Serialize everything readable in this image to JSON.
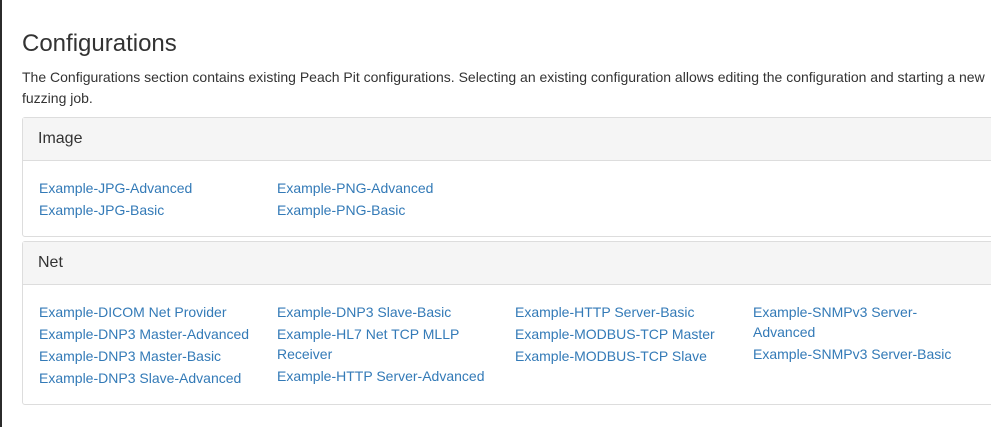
{
  "page": {
    "title": "Configurations",
    "description": "The Configurations section contains existing Peach Pit configurations. Selecting an existing configuration allows editing the configuration and starting a new fuzzing job."
  },
  "panels": [
    {
      "heading": "Image",
      "columns": [
        [
          "Example-JPG-Advanced",
          "Example-JPG-Basic"
        ],
        [
          "Example-PNG-Advanced",
          "Example-PNG-Basic"
        ]
      ]
    },
    {
      "heading": "Net",
      "columns": [
        [
          "Example-DICOM Net Provider",
          "Example-DNP3 Master-Advanced",
          "Example-DNP3 Master-Basic",
          "Example-DNP3 Slave-Advanced"
        ],
        [
          "Example-DNP3 Slave-Basic",
          "Example-HL7 Net TCP MLLP Receiver",
          "Example-HTTP Server-Advanced"
        ],
        [
          "Example-HTTP Server-Basic",
          "Example-MODBUS-TCP Master",
          "Example-MODBUS-TCP Slave"
        ],
        [
          "Example-SNMPv3 Server-Advanced",
          "Example-SNMPv3 Server-Basic"
        ]
      ]
    }
  ],
  "colors": {
    "link": "#337ab7",
    "heading_bg": "#f5f5f5",
    "border": "#dddddd",
    "text": "#333333"
  }
}
